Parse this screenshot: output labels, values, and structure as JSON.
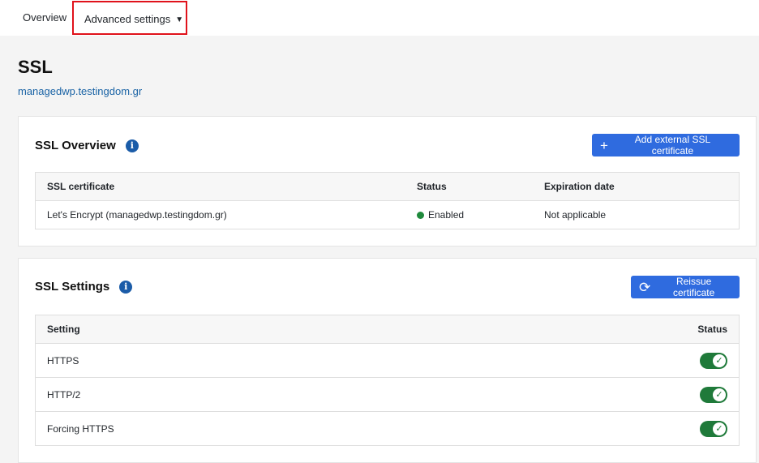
{
  "nav": {
    "overview_label": "Overview",
    "advanced_label": "Advanced settings",
    "advanced_caret": "▼"
  },
  "page": {
    "title": "SSL",
    "domain": "managedwp.testingdom.gr"
  },
  "overview": {
    "title": "SSL Overview",
    "info_glyph": "i",
    "add_button_icon": "+",
    "add_button_label": "Add external SSL certificate",
    "columns": [
      "SSL certificate",
      "Status",
      "Expiration date"
    ],
    "rows": [
      {
        "certificate": "Let's Encrypt (managedwp.testingdom.gr)",
        "status": "Enabled",
        "expiration": "Not applicable"
      }
    ]
  },
  "settings": {
    "title": "SSL Settings",
    "info_glyph": "i",
    "reissue_button_icon": "⟳",
    "reissue_button_label": "Reissue certificate",
    "columns": [
      "Setting",
      "Status"
    ],
    "rows": [
      {
        "name": "HTTPS",
        "enabled": true
      },
      {
        "name": "HTTP/2",
        "enabled": true
      },
      {
        "name": "Forcing HTTPS",
        "enabled": true
      }
    ],
    "check_glyph": "✓"
  },
  "colors": {
    "accent": "#2f6bdf",
    "link": "#1a63a5",
    "enabled": "#1f8a3c",
    "toggle_on": "#1f7a3a",
    "highlight": "#e0121b"
  }
}
